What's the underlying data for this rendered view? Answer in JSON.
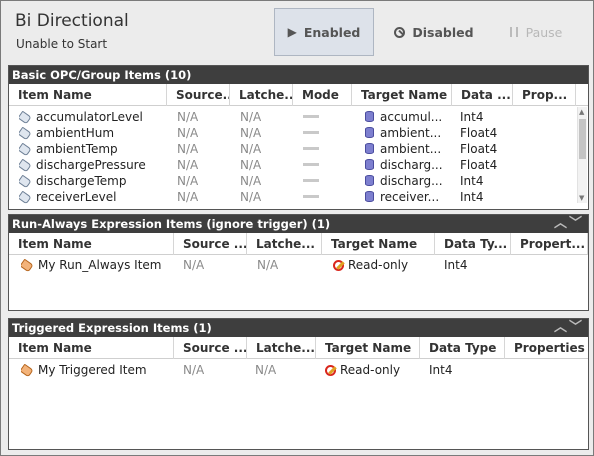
{
  "header": {
    "title": "Bi Directional",
    "subtitle": "Unable to Start",
    "buttons": {
      "enabled": "Enabled",
      "disabled": "Disabled",
      "pause": "Pause"
    }
  },
  "opc_section": {
    "title": "Basic OPC/Group Items (10)",
    "columns": [
      "Item Name",
      "Source...",
      "Latche...",
      "Mode",
      "Target Name",
      "Data ...",
      "Prop..."
    ],
    "rows": [
      {
        "name": "accumulatorLevel",
        "source": "N/A",
        "latch": "N/A",
        "target": "accumul...",
        "type": "Int4"
      },
      {
        "name": "ambientHum",
        "source": "N/A",
        "latch": "N/A",
        "target": "ambient...",
        "type": "Float4"
      },
      {
        "name": "ambientTemp",
        "source": "N/A",
        "latch": "N/A",
        "target": "ambient...",
        "type": "Float4"
      },
      {
        "name": "dischargePressure",
        "source": "N/A",
        "latch": "N/A",
        "target": "discharg...",
        "type": "Float4"
      },
      {
        "name": "dischargeTemp",
        "source": "N/A",
        "latch": "N/A",
        "target": "discharg...",
        "type": "Int4"
      },
      {
        "name": "receiverLevel",
        "source": "N/A",
        "latch": "N/A",
        "target": "receiver...",
        "type": "Int4"
      }
    ]
  },
  "run_always_section": {
    "title": "Run-Always Expression Items (ignore trigger) (1)",
    "columns": [
      "Item Name",
      "Source ...",
      "Latche...",
      "Target Name",
      "Data Ty...",
      "Propert..."
    ],
    "rows": [
      {
        "name": "My Run_Always Item",
        "source": "N/A",
        "latch": "N/A",
        "target": "Read-only",
        "type": "Int4"
      }
    ]
  },
  "triggered_section": {
    "title": "Triggered Expression Items (1)",
    "columns": [
      "Item Name",
      "Source ...",
      "Latche...",
      "Target Name",
      "Data Type",
      "Properties"
    ],
    "rows": [
      {
        "name": "My Triggered Item",
        "source": "N/A",
        "latch": "N/A",
        "target": "Read-only",
        "type": "Int4"
      }
    ]
  },
  "icons": {
    "play": "play-icon",
    "disabled": "disabled-circle-icon",
    "pause": "pause-icon",
    "tag": "tag-icon",
    "database": "database-icon",
    "readonly": "read-only-icon",
    "collapse": "chevron-up-icon",
    "expand": "chevron-down-icon"
  },
  "colors": {
    "section_header": "#3e3e3e",
    "enabled_button_bg": "#dde2ea",
    "readonly_icon": "#d9261c"
  }
}
